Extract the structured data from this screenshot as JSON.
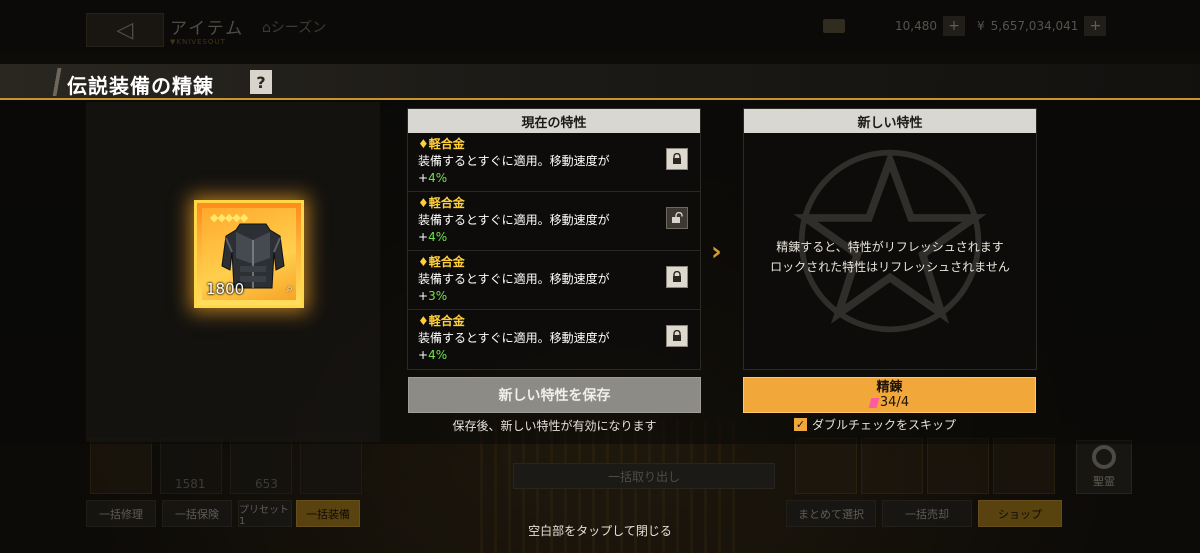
{
  "topbar": {
    "title": "アイテム",
    "subtitle": "▼KNIVESOUT",
    "season_link": "シーズン",
    "currency_gold": "10,480",
    "currency_yen": "5,657,034,041",
    "plus": "+"
  },
  "modal": {
    "title": "伝説装備の精錬",
    "help": "?",
    "item": {
      "value": "1800",
      "rarity_diamonds": "◆◆◆◆◆"
    },
    "current_panel": {
      "header": "現在の特性",
      "traits": [
        {
          "name": "♦軽合金",
          "desc": "装備するとすぐに適用。移動速度が",
          "sign": "+",
          "pct": "4%",
          "locked": true
        },
        {
          "name": "♦軽合金",
          "desc": "装備するとすぐに適用。移動速度が",
          "sign": "+",
          "pct": "4%",
          "locked": false
        },
        {
          "name": "♦軽合金",
          "desc": "装備するとすぐに適用。移動速度が",
          "sign": "+",
          "pct": "3%",
          "locked": true
        },
        {
          "name": "♦軽合金",
          "desc": "装備するとすぐに適用。移動速度が",
          "sign": "+",
          "pct": "4%",
          "locked": true
        }
      ]
    },
    "new_panel": {
      "header": "新しい特性",
      "message_line1": "精錬すると、特性がリフレッシュされます",
      "message_line2": "ロックされた特性はリフレッシュされません"
    },
    "save_button": "新しい特性を保存",
    "save_note": "保存後、新しい特性が有効になります",
    "refine_button": {
      "label": "精錬",
      "cost": "34/4"
    },
    "skip_checkbox": {
      "label": "ダブルチェックをスキップ",
      "checked": true
    }
  },
  "background": {
    "buttons": [
      "一括修理",
      "一括保険",
      "プリセット1",
      "一括装備",
      "まとめて選択",
      "一括売却",
      "ショップ"
    ],
    "bulk_take": "一括取り出し",
    "holy": "聖霊",
    "slot_values": [
      "1581",
      "653"
    ]
  },
  "close_hint": "空白部をタップして閉じる",
  "colors": {
    "accent_gold": "#c9952a",
    "refine_orange": "#f2a73a",
    "trait_name": "#ffcf3a",
    "pct_green": "#6fe24b"
  }
}
